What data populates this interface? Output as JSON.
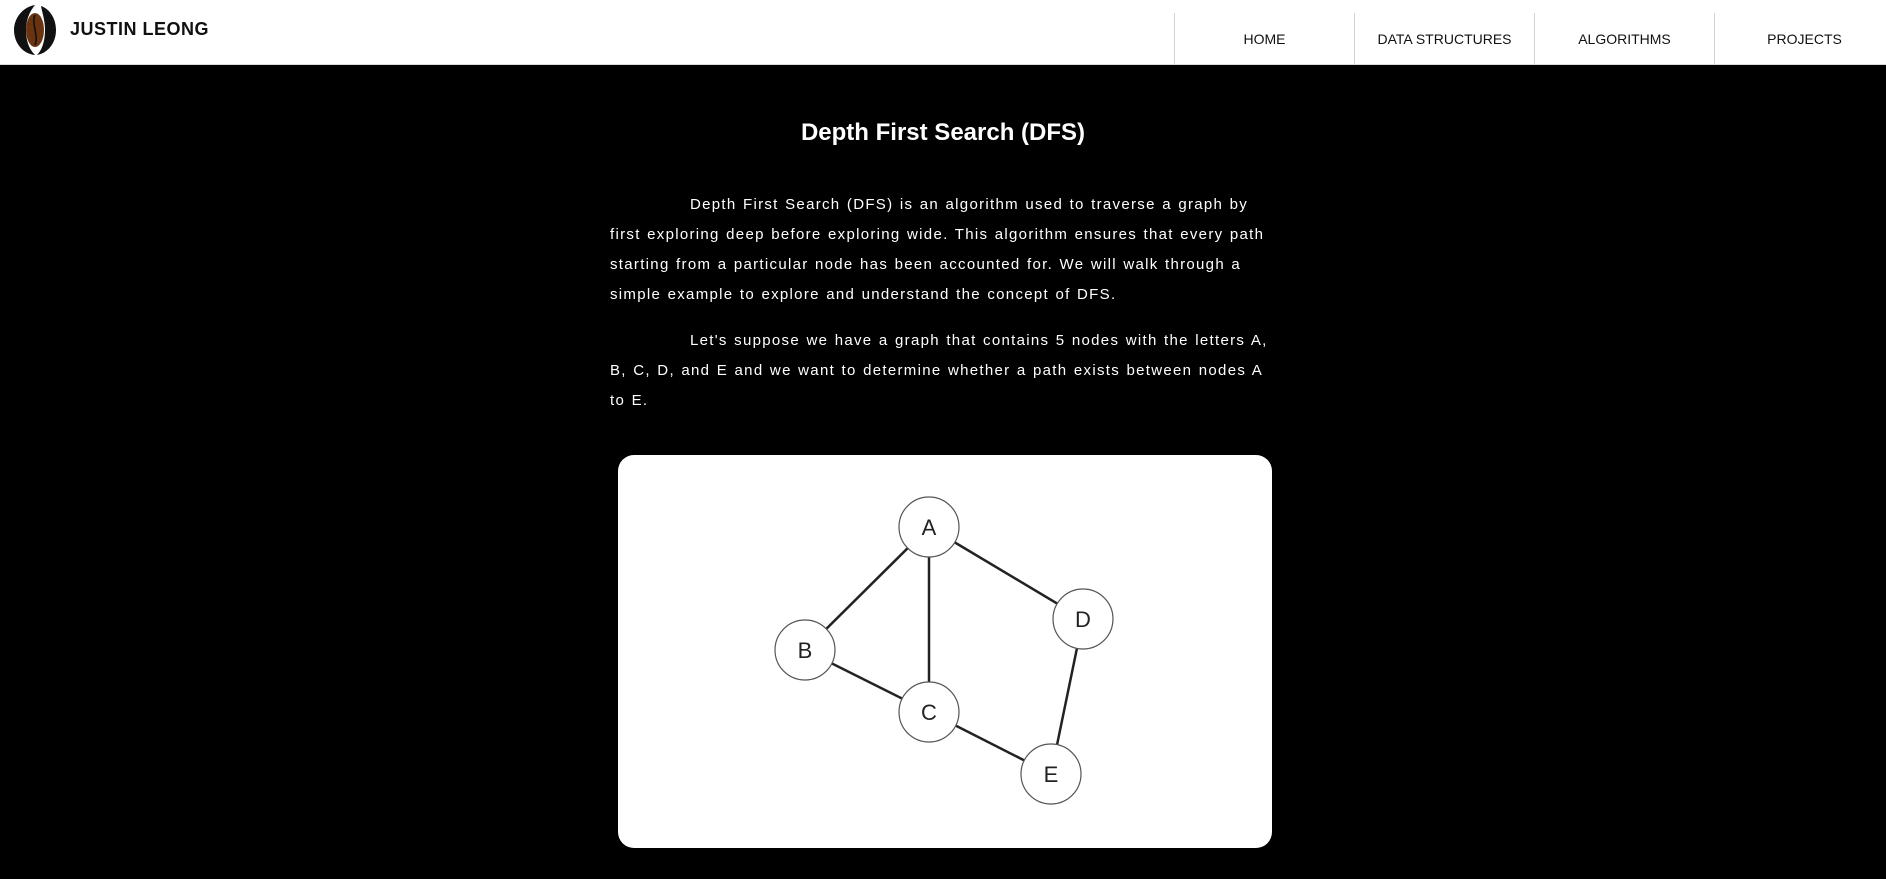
{
  "header": {
    "brand": "JUSTIN LEONG",
    "logo_icon": "coffee-bean-logo",
    "nav": [
      "HOME",
      "DATA STRUCTURES",
      "ALGORITHMS",
      "PROJECTS"
    ]
  },
  "main": {
    "title": "Depth First Search (DFS)",
    "paragraphs": [
      "Depth First Search (DFS) is an algorithm used to traverse a graph by first exploring deep before exploring wide. This algorithm ensures that every path starting from a particular node has been accounted for. We will walk through a simple example to explore and understand the concept of DFS.",
      "Let's suppose we have a graph that contains 5 nodes with the letters A, B, C, D, and E and we want to determine whether a path exists between nodes A to E."
    ]
  },
  "graph": {
    "nodes": [
      "A",
      "B",
      "C",
      "D",
      "E"
    ],
    "edges": [
      [
        "A",
        "B"
      ],
      [
        "A",
        "C"
      ],
      [
        "A",
        "D"
      ],
      [
        "B",
        "C"
      ],
      [
        "C",
        "E"
      ],
      [
        "D",
        "E"
      ]
    ]
  },
  "colors": {
    "background": "#000000",
    "navbar": "#ffffff",
    "node_fill": "#ffffff",
    "node_stroke": "#555555",
    "edge": "#222222"
  }
}
